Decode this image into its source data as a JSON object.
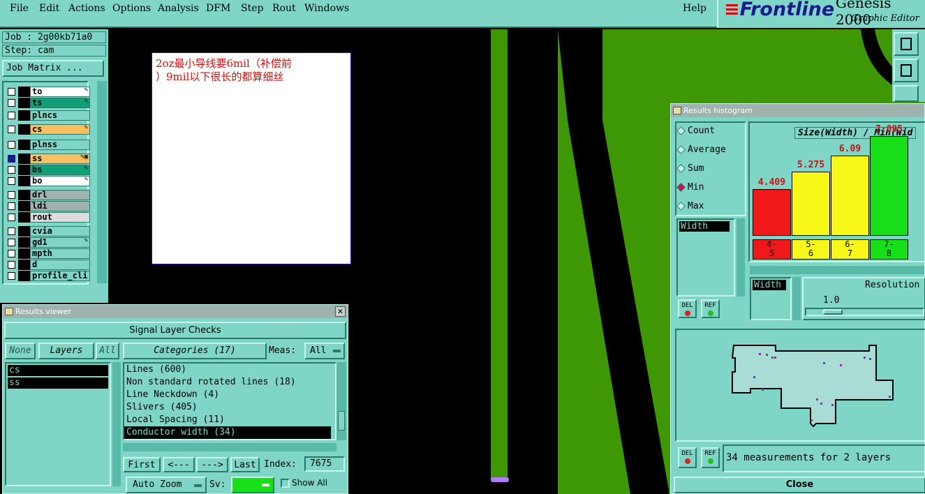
{
  "menu": {
    "items": [
      "File",
      "Edit",
      "Actions",
      "Options",
      "Analysis",
      "DFM",
      "Step",
      "Rout",
      "Windows"
    ],
    "help": "Help"
  },
  "logo": {
    "brand": "Frontline",
    "product": "Genesis 2000",
    "subtitle": "Graphic Editor"
  },
  "job": {
    "job_label": "Job : 2g00kb71a0",
    "step_label": "Step: cam",
    "matrix_button": "Job Matrix ..."
  },
  "layers": [
    {
      "name": "to",
      "color": "#ffffff",
      "checked": false,
      "mark": "✎"
    },
    {
      "name": "ts",
      "color": "#10a078",
      "checked": false,
      "mark": "✎"
    },
    {
      "name": "plncs",
      "color": "#7fd6c6",
      "checked": false,
      "mark": ""
    },
    {
      "name": "cs",
      "color": "#f8c060",
      "checked": false,
      "mark": "✎"
    },
    {
      "name": "plnss",
      "color": "#7fd6c6",
      "checked": false,
      "mark": ""
    },
    {
      "name": "ss",
      "color": "#f8c060",
      "checked": true,
      "mark": "✎▣"
    },
    {
      "name": "bs",
      "color": "#10a078",
      "checked": false,
      "mark": "✎"
    },
    {
      "name": "bo",
      "color": "#ffffff",
      "checked": false,
      "mark": "✎"
    },
    {
      "name": "drl",
      "color": "#9fb2ad",
      "checked": false,
      "mark": ""
    },
    {
      "name": "ldi",
      "color": "#9fb2ad",
      "checked": false,
      "mark": ""
    },
    {
      "name": "rout",
      "color": "#dcdcdc",
      "checked": false,
      "mark": ""
    },
    {
      "name": "cvia",
      "color": "#7fd6c6",
      "checked": false,
      "mark": ""
    },
    {
      "name": "gd1",
      "color": "#7fd6c6",
      "checked": false,
      "mark": "✎"
    },
    {
      "name": "mpth",
      "color": "#7fd6c6",
      "checked": false,
      "mark": ""
    },
    {
      "name": "d",
      "color": "#7fd6c6",
      "checked": false,
      "mark": ""
    },
    {
      "name": "profile_cli",
      "color": "#7fd6c6",
      "checked": false,
      "mark": ""
    }
  ],
  "note": {
    "text": "2oz最小导线要6mil（补偿前\n）9mil以下很长的都算细丝"
  },
  "results_viewer": {
    "title": "Results viewer",
    "header": "Signal Layer Checks",
    "none_btn": "None",
    "layers_btn": "Layers",
    "all_btn": "All",
    "layers": [
      "cs",
      "ss"
    ],
    "categories_btn": "Categories (17)",
    "meas_label": "Meas:",
    "meas_value": "All",
    "categories": [
      "Lines (600)",
      "Non standard rotated lines (18)",
      "Line Neckdown (4)",
      "Slivers (405)",
      "Local Spacing (11)",
      "Conductor width (34)"
    ],
    "selected_category": 5,
    "first_btn": "First",
    "prev_btn": "<---",
    "next_btn": "--->",
    "last_btn": "Last",
    "index_label": "Index:",
    "index_value": "7675",
    "autozoom": "Auto Zoom",
    "sv_label": "Sv:",
    "show_all": "Show All"
  },
  "histogram": {
    "title": "Results histogram",
    "modes": [
      "Count",
      "Average",
      "Sum",
      "Min",
      "Max"
    ],
    "selected_mode": "Min",
    "attribute": "Width",
    "attribute2": "Width",
    "resolution_label": "Resolution",
    "resolution_value": "1.0",
    "del": "DEL",
    "ref": "REF",
    "measurements": "34 measurements for 2 layers",
    "close": "Close"
  },
  "chart_data": {
    "type": "bar",
    "title": "Size(Width) / Min(Wid",
    "categories": [
      "4-5",
      "5-6",
      "6-7",
      "7-8"
    ],
    "values": [
      4.409,
      5.275,
      6.09,
      7.095
    ],
    "value_labels": [
      "4.409",
      "5.275",
      "6.09",
      "7.095"
    ],
    "bar_colors": [
      "#f01818",
      "#f8f818",
      "#f8f818",
      "#18e018"
    ]
  }
}
